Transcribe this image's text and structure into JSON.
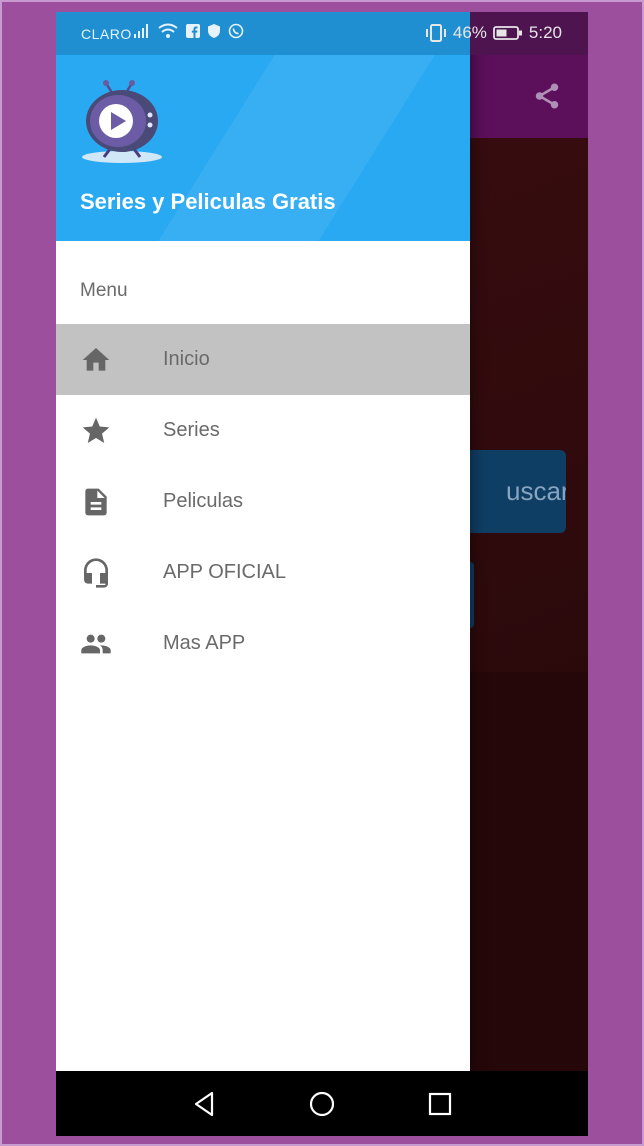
{
  "status_bar": {
    "carrier": "CLARO",
    "battery": "46%",
    "time": "5:20"
  },
  "background_app": {
    "search_button_label": "uscar",
    "toolbar_color": "#5c0f5a"
  },
  "drawer": {
    "header_title": "Series y Peliculas Gratis",
    "header_color": "#2aa9f3",
    "menu_heading": "Menu",
    "items": [
      {
        "label": "Inicio",
        "icon": "home-icon",
        "active": true
      },
      {
        "label": "Series",
        "icon": "star-icon",
        "active": false
      },
      {
        "label": "Peliculas",
        "icon": "document-icon",
        "active": false
      },
      {
        "label": "APP OFICIAL",
        "icon": "headset-icon",
        "active": false
      },
      {
        "label": "Mas APP",
        "icon": "people-icon",
        "active": false
      }
    ]
  },
  "nav_bar": {
    "buttons": [
      "back-icon",
      "home-circle-icon",
      "recents-icon"
    ]
  }
}
